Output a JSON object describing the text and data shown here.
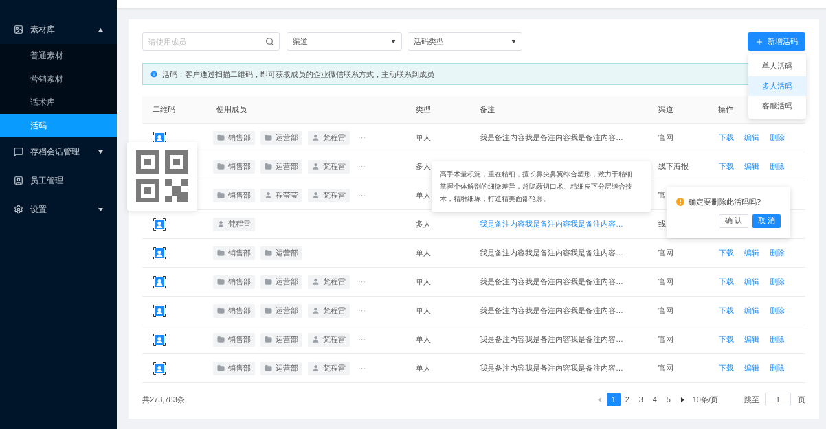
{
  "sidebar": {
    "items": [
      {
        "label": "素材库",
        "expanded": true,
        "children": [
          {
            "label": "普通素材",
            "selected": false
          },
          {
            "label": "营销素材",
            "selected": false
          },
          {
            "label": "话术库",
            "selected": false
          },
          {
            "label": "活码",
            "selected": true
          }
        ]
      },
      {
        "label": "存档会话管理",
        "expanded": false
      },
      {
        "label": "员工管理"
      },
      {
        "label": "设置",
        "expanded": false
      }
    ]
  },
  "filters": {
    "search": {
      "placeholder": "请使用成员"
    },
    "selects": [
      {
        "value": "渠道"
      },
      {
        "value": "活码类型"
      }
    ]
  },
  "new_button": {
    "label": "新增活码",
    "menu": [
      {
        "label": "单人活码",
        "selected": false
      },
      {
        "label": "多人活码",
        "selected": true
      },
      {
        "label": "客服活码",
        "selected": false
      }
    ]
  },
  "alert": {
    "text": "活码：客户通过扫描二维码，即可获取成员的企业微信联系方式，主动联系到成员"
  },
  "table": {
    "columns": [
      "二维码",
      "使用成员",
      "类型",
      "备注",
      "渠道",
      "操作"
    ],
    "rows": [
      {
        "qr": true,
        "members": [
          {
            "kind": "dept",
            "name": "销售部"
          },
          {
            "kind": "dept",
            "name": "运营部"
          },
          {
            "kind": "person",
            "name": "梵程雷"
          }
        ],
        "more": "···",
        "type": "单人",
        "note": "我是备注内容我是备注内容我是备注内容…",
        "note_hovered": false,
        "channel": "官网",
        "actions": [
          "下载",
          "编辑",
          "删除"
        ]
      },
      {
        "members": [
          {
            "kind": "dept",
            "name": "销售部"
          },
          {
            "kind": "dept",
            "name": "运营部"
          },
          {
            "kind": "person",
            "name": "梵程雷"
          }
        ],
        "more": "···",
        "type": "多人",
        "channel": "线下海报",
        "actions": [
          "下载",
          "编辑",
          "删除"
        ]
      },
      {
        "members": [
          {
            "kind": "dept",
            "name": "销售部"
          },
          {
            "kind": "person",
            "name": "程莹莹"
          },
          {
            "kind": "person",
            "name": "梵程雷"
          }
        ],
        "more": "···",
        "type": "单人",
        "channel": "官"
      },
      {
        "qr": true,
        "members": [
          {
            "kind": "person",
            "name": "梵程雷"
          }
        ],
        "type": "多人",
        "note": "我是备注内容我是备注内容我是备注内容…",
        "note_hovered": true,
        "channel": "线"
      },
      {
        "qr": true,
        "members": [
          {
            "kind": "dept",
            "name": "销售部"
          },
          {
            "kind": "dept",
            "name": "运营部"
          }
        ],
        "type": "单人",
        "note": "我是备注内容我是备注内容我是备注内容…",
        "note_hovered": false,
        "channel": "官网",
        "actions": [
          "下载",
          "编辑",
          "删除"
        ]
      },
      {
        "qr": true,
        "members": [
          {
            "kind": "dept",
            "name": "销售部"
          },
          {
            "kind": "dept",
            "name": "运营部"
          },
          {
            "kind": "person",
            "name": "梵程雷"
          }
        ],
        "more": "···",
        "type": "单人",
        "note": "我是备注内容我是备注内容我是备注内容…",
        "note_hovered": false,
        "channel": "官网",
        "actions": [
          "下载",
          "编辑",
          "删除"
        ]
      },
      {
        "qr": true,
        "members": [
          {
            "kind": "dept",
            "name": "销售部"
          },
          {
            "kind": "dept",
            "name": "运营部"
          },
          {
            "kind": "person",
            "name": "梵程雷"
          }
        ],
        "more": "···",
        "type": "单人",
        "note": "我是备注内容我是备注内容我是备注内容…",
        "note_hovered": false,
        "channel": "官网",
        "actions": [
          "下载",
          "编辑",
          "删除"
        ]
      },
      {
        "qr": true,
        "members": [
          {
            "kind": "dept",
            "name": "销售部"
          },
          {
            "kind": "dept",
            "name": "运营部"
          },
          {
            "kind": "person",
            "name": "梵程雷"
          }
        ],
        "more": "···",
        "type": "单人",
        "note": "我是备注内容我是备注内容我是备注内容…",
        "note_hovered": false,
        "channel": "官网",
        "actions": [
          "下载",
          "编辑",
          "删除"
        ]
      },
      {
        "qr": true,
        "members": [
          {
            "kind": "dept",
            "name": "销售部"
          },
          {
            "kind": "dept",
            "name": "运营部"
          },
          {
            "kind": "person",
            "name": "梵程雷"
          }
        ],
        "more": "···",
        "type": "单人",
        "note": "我是备注内容我是备注内容我是备注内容…",
        "note_hovered": false,
        "channel": "官网",
        "actions": [
          "下载",
          "编辑",
          "删除"
        ]
      }
    ]
  },
  "tooltip": {
    "text": "高手术量积淀，重在精细，擅长鼻尖鼻翼综合塑形，致力于精细掌握个体解剖的细微差异，超隐蔽切口术、精细皮下分层缝合技术，精雕细琢，打造精美面部轮廓。"
  },
  "popconfirm": {
    "message": "确定要删除此活码吗?",
    "buttons": [
      {
        "label": "确 认",
        "primary": false
      },
      {
        "label": "取 消",
        "primary": true
      }
    ]
  },
  "pagination": {
    "total": "共273,783条",
    "pages": [
      {
        "label": "1",
        "selected": true
      },
      {
        "label": "2",
        "selected": false
      },
      {
        "label": "3",
        "selected": false
      },
      {
        "label": "4",
        "selected": false
      },
      {
        "label": "5",
        "selected": false
      }
    ],
    "page_size": "10条/页",
    "jump_label": "跳至",
    "jump_value": "1",
    "page_unit": "页"
  }
}
